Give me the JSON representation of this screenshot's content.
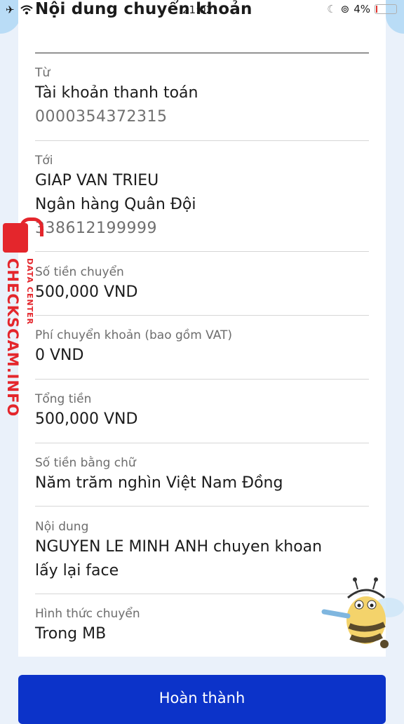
{
  "status": {
    "time": "21:02",
    "battery": "4%"
  },
  "title": "Nội dung chuyển khoản",
  "from": {
    "label": "Từ",
    "account_name": "Tài khoản thanh toán",
    "account_number": "0000354372315"
  },
  "to": {
    "label": "Tới",
    "name": "GIAP VAN TRIEU",
    "bank": "Ngân hàng Quân Đội",
    "account_number": "338612199999"
  },
  "amount": {
    "label": "Số tiền chuyển",
    "value": "500,000 VND"
  },
  "fee": {
    "label": "Phí chuyển khoản (bao gồm VAT)",
    "value": "0 VND"
  },
  "total": {
    "label": "Tổng tiền",
    "value": "500,000 VND"
  },
  "amount_words": {
    "label": "Số tiền bằng chữ",
    "value": "Năm trăm nghìn Việt Nam Đồng"
  },
  "content": {
    "label": "Nội dung",
    "line1": "NGUYEN LE MINH ANH chuyen khoan",
    "line2": "lấy lại face"
  },
  "method": {
    "label": "Hình thức chuyển",
    "value": "Trong MB"
  },
  "button": {
    "label": "Hoàn thành"
  },
  "watermark": {
    "main": "CHECKSCAM.INFO",
    "sub": "DATA CENTER"
  },
  "colors": {
    "primary_button": "#0c33c9",
    "watermark": "#e4262c"
  }
}
